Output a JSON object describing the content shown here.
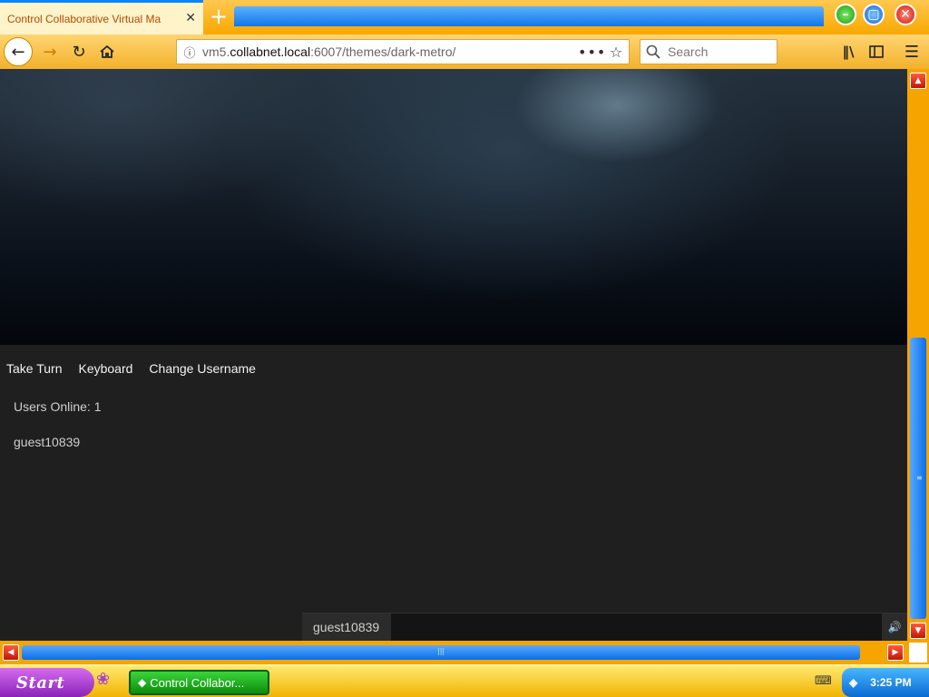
{
  "browser": {
    "tab_title": "Control Collaborative Virtual Ma",
    "tab_close": "✕",
    "new_tab": "+",
    "url_prefix": "vm5.",
    "url_host": "collabnet.local",
    "url_suffix": ":6007/themes/dark-metro/",
    "url_more": "•••",
    "search_placeholder": "Search"
  },
  "page": {
    "menu": [
      "Take Turn",
      "Keyboard",
      "Change Username"
    ],
    "users_online": "Users Online: 1",
    "users": [
      "guest10839"
    ],
    "chat_username": "guest10839"
  },
  "taskbar": {
    "start_label": "Start",
    "task_item": "Control Collabor...",
    "clock": "3:25 PM"
  },
  "icons": {
    "back": "back-arrow-icon",
    "forward": "forward-arrow-icon",
    "reload": "reload-icon",
    "home": "home-icon",
    "info": "info-icon",
    "star": "bookmark-star-icon",
    "search": "search-icon",
    "library": "library-icon",
    "sidebar": "sidebar-icon",
    "menu": "hamburger-menu-icon",
    "volume": "volume-icon"
  },
  "colors": {
    "tab_accent": "#0a84ff",
    "chrome_orange": "#f7a800",
    "page_bg": "#1f1f1f"
  }
}
